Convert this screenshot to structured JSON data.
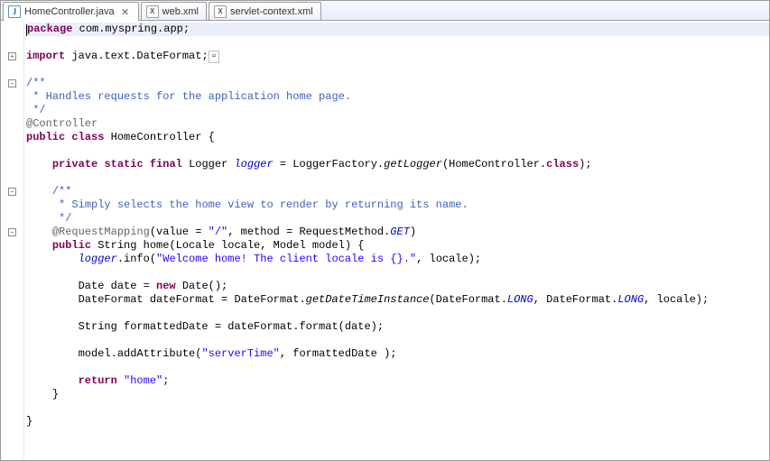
{
  "tabs": [
    {
      "label": "HomeController.java",
      "icon": "J",
      "active": true
    },
    {
      "label": "web.xml",
      "icon": "X",
      "active": false
    },
    {
      "label": "servlet-context.xml",
      "icon": "X",
      "active": false
    }
  ],
  "code": {
    "l1_package_kw": "package",
    "l1_package_name": " com.myspring.app;",
    "l3_import_kw": "import",
    "l3_import_name": " java.text.DateFormat;",
    "l5_jd_open": "/**",
    "l6_jd_body": " * Handles requests for the application home page.",
    "l7_jd_close": " */",
    "l8_annotation": "@Controller",
    "l9_public": "public",
    "l9_class": "class",
    "l9_name": " HomeController {",
    "l11_priv": "private",
    "l11_static": "static",
    "l11_final": "final",
    "l11_type": " Logger ",
    "l11_field": "logger",
    "l11_eq": " = LoggerFactory.",
    "l11_get": "getLogger",
    "l11_arg": "(HomeController.",
    "l11_class_kw": "class",
    "l11_end": ");",
    "l13_jd_open": "/**",
    "l14_jd_body": " * Simply selects the home view to render by returning its name.",
    "l15_jd_close": " */",
    "l16_ann_pre": "@RequestMapping",
    "l16_ann_p1": "(value = ",
    "l16_str1": "\"/\"",
    "l16_p2": ", method = RequestMethod.",
    "l16_get": "GET",
    "l16_end": ")",
    "l17_public": "public",
    "l17_sig": " String home(Locale locale, Model model) {",
    "l18_logger": "logger",
    "l18_info": ".info(",
    "l18_str": "\"Welcome home! The client locale is {}.\"",
    "l18_end": ", locale);",
    "l20_pre": "Date date = ",
    "l20_new": "new",
    "l20_end": " Date();",
    "l21_pre": "DateFormat dateFormat = DateFormat.",
    "l21_m": "getDateTimeInstance",
    "l21_p1": "(DateFormat.",
    "l21_c1": "LONG",
    "l21_p2": ", DateFormat.",
    "l21_c2": "LONG",
    "l21_p3": ", locale);",
    "l23": "String formattedDate = dateFormat.format(date);",
    "l25_pre": "model.addAttribute(",
    "l25_str": "\"serverTime\"",
    "l25_end": ", formattedDate );",
    "l27_ret": "return",
    "l27_str": "\"home\"",
    "l27_end": ";",
    "l28": "}",
    "l30": "}"
  },
  "glyphs": {
    "close": "✕",
    "plus": "+",
    "minus": "−",
    "collapsed": "▫"
  }
}
